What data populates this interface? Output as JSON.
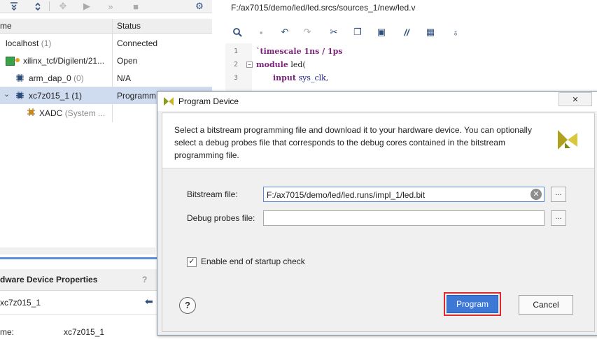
{
  "hardware": {
    "columns": {
      "name": "me",
      "status": "Status"
    },
    "rows": [
      {
        "name": "localhost",
        "count": "(1)",
        "status": "Connected",
        "icon": "server-icon"
      },
      {
        "name": "xilinx_tcf/Digilent/21...",
        "count": "",
        "status": "Open",
        "icon": "cable-icon"
      },
      {
        "name": "arm_dap_0",
        "count": "(0)",
        "status": "N/A",
        "icon": "chip-icon"
      },
      {
        "name": "xc7z015_1",
        "count": "(1)",
        "status": "Programm",
        "icon": "chip-icon"
      },
      {
        "name": "XADC",
        "count": "(System ...",
        "status": "",
        "icon": "sensor-icon"
      }
    ]
  },
  "properties": {
    "title": "dware Device Properties",
    "help": "?",
    "device": "xc7z015_1",
    "name_label": "me:",
    "name_value": "xc7z015_1"
  },
  "editor": {
    "path": "F:/ax7015/demo/led/led.srcs/sources_1/new/led.v",
    "lines": [
      {
        "num": "1",
        "text": "`timescale 1ns / 1ps"
      },
      {
        "num": "2",
        "kw": "module",
        "text": " led("
      },
      {
        "num": "3",
        "kw": "input",
        "text": " sys_clk,"
      }
    ]
  },
  "dialog": {
    "title": "Program Device",
    "close_label": "✕",
    "description": "Select a bitstream programming file and download it to your hardware device. You can optionally select a debug probes file that corresponds to the debug cores contained in the bitstream programming file.",
    "bitstream_label": "Bitstream file:",
    "bitstream_value": "F:/ax7015/demo/led/led.runs/impl_1/led.bit",
    "debug_label": "Debug probes file:",
    "debug_value": "",
    "browse_label": "...",
    "checkbox_label": "Enable end of startup check",
    "checkbox_checked": true,
    "help_label": "?",
    "program_label": "Program",
    "cancel_label": "Cancel"
  },
  "colors": {
    "selection": "#cfdcef",
    "accent": "#3d78d6",
    "highlight": "#e0292d"
  }
}
